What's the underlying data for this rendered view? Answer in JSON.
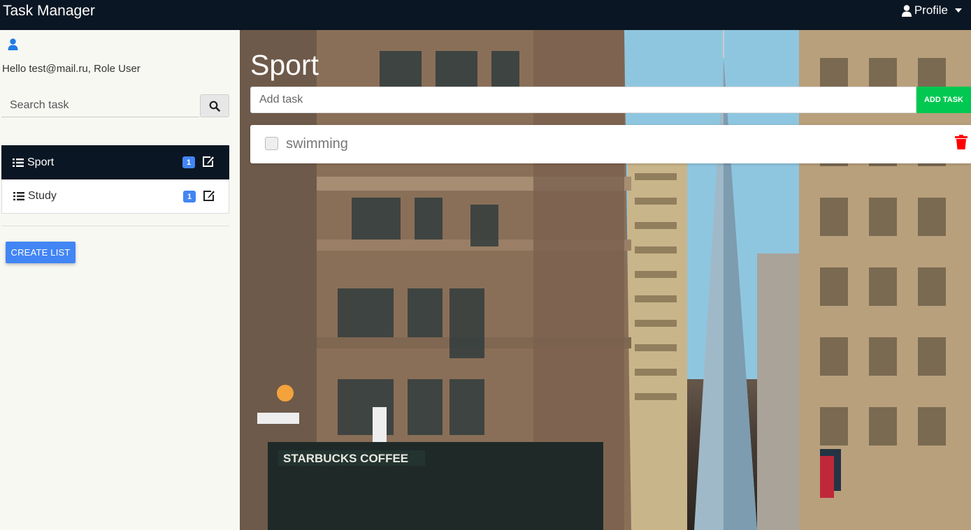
{
  "navbar": {
    "brand": "Task Manager",
    "profile_label": "Profile",
    "profile_icon": "user-icon"
  },
  "sidebar": {
    "user_icon": "user-icon",
    "greeting": "Hello test@mail.ru, Role User",
    "search": {
      "placeholder": "Search task",
      "value": ""
    },
    "lists": [
      {
        "label": "Sport",
        "count": "1",
        "active": true
      },
      {
        "label": "Study",
        "count": "1",
        "active": false
      }
    ],
    "create_label": "CREATE LIST"
  },
  "main": {
    "title": "Sport",
    "add_task": {
      "placeholder": "Add task",
      "value": ""
    },
    "add_label": "ADD TASK",
    "tasks": [
      {
        "text": "swimming",
        "done": false
      }
    ]
  },
  "colors": {
    "navbar": "#0a1623",
    "accent_blue": "#4285f4",
    "add_green": "#00c851",
    "delete_red": "#ff0000"
  }
}
